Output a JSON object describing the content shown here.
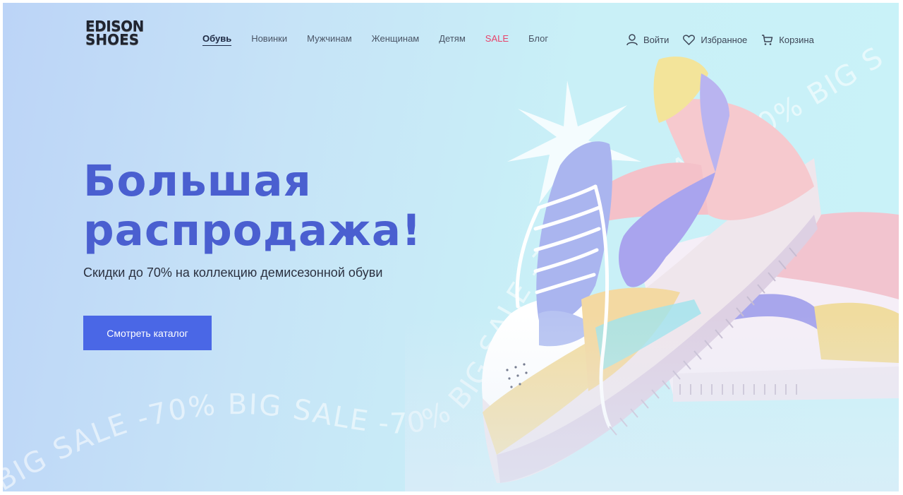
{
  "brand": {
    "line1": "EDISON",
    "line2": "SHOES"
  },
  "nav": {
    "items": [
      {
        "label": "Обувь"
      },
      {
        "label": "Новинки"
      },
      {
        "label": "Мужчинам"
      },
      {
        "label": "Женщинам"
      },
      {
        "label": "Детям"
      },
      {
        "label": "SALE"
      },
      {
        "label": "Блог"
      }
    ]
  },
  "actions": {
    "login": {
      "label": "Войти",
      "icon": "user-icon"
    },
    "favorites": {
      "label": "Избранное",
      "icon": "heart-icon"
    },
    "cart": {
      "label": "Корзина",
      "icon": "cart-icon"
    }
  },
  "hero": {
    "title_line1": "Большая",
    "title_line2": "распродажа!",
    "subtitle": "Скидки до 70% на коллекцию демисезонной обуви",
    "cta_label": "Смотреть каталог",
    "banner_text": "BIG SALE -70% BIG SALE -70% BIG SALE -70% BIG SALE -70% BIG S"
  },
  "colors": {
    "accent": "#4a67e6",
    "title": "#4a5fd0",
    "sale": "#e8436b"
  }
}
